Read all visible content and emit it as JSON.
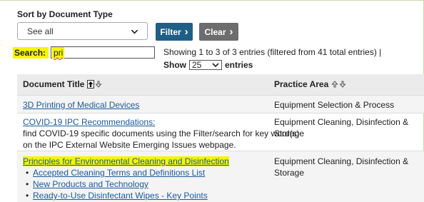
{
  "filter": {
    "sort_label": "Sort by Document Type",
    "select_value": "See all",
    "filter_label": "Filter",
    "clear_label": "Clear"
  },
  "search": {
    "label": "Search:",
    "value": "pri",
    "highlight_color": "#f5f500"
  },
  "info": {
    "showing_text": "Showing 1 to 3 of 3 entries (filtered from 41 total entries) |",
    "show_label": "Show",
    "show_value": "25",
    "entries_label": "entries"
  },
  "table": {
    "headers": [
      "Document Title",
      "Practice Area"
    ],
    "rows": [
      {
        "title": "3D Printing of Medical Devices",
        "area": "Equipment Selection & Process"
      },
      {
        "title": "COVID-19 IPC Recommendations:",
        "desc_line1": "find COVID-19 specific documents using the Filter/search for key word(s)",
        "desc_line2": "on the IPC External Website Emerging Issues webpage.",
        "area_line1": "Equipment Cleaning, Disinfection &",
        "area_line2": "Storage"
      },
      {
        "title": "Principles for Environmental Cleaning and Disinfection",
        "sub_items": [
          "Accepted Cleaning Terms and Definitions List",
          "New Products and Technology",
          "Ready-to-Use Disinfectant Wipes - Key Points"
        ],
        "area_line1": "Equipment Cleaning, Disinfection &",
        "area_line2": "Storage"
      }
    ]
  },
  "colors": {
    "filter_button": "#1f5f86",
    "clear_button": "#6d6d6d",
    "link": "#1a5a9a",
    "header_bg": "#ebebeb"
  },
  "icons": {
    "select_chevron": "chevron-down-icon",
    "sort_up": "sort-up-icon",
    "sort_down": "sort-down-icon"
  }
}
